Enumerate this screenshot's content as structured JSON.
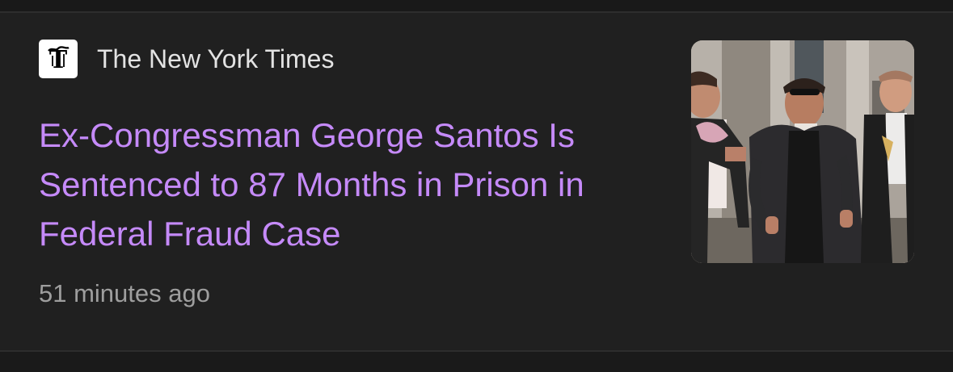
{
  "article": {
    "source": {
      "name": "The New York Times",
      "logo_icon": "nyt-t-logo-icon"
    },
    "headline": "Ex-Congressman George Santos Is Sentenced to 87 Months in Prison in Federal Fraud Case",
    "timestamp": "51 minutes ago",
    "thumbnail_icon": "news-photo-thumbnail"
  },
  "colors": {
    "background": "#202020",
    "headline": "#c58af9",
    "source_text": "#e3e3e3",
    "timestamp_text": "#9e9e9e"
  }
}
